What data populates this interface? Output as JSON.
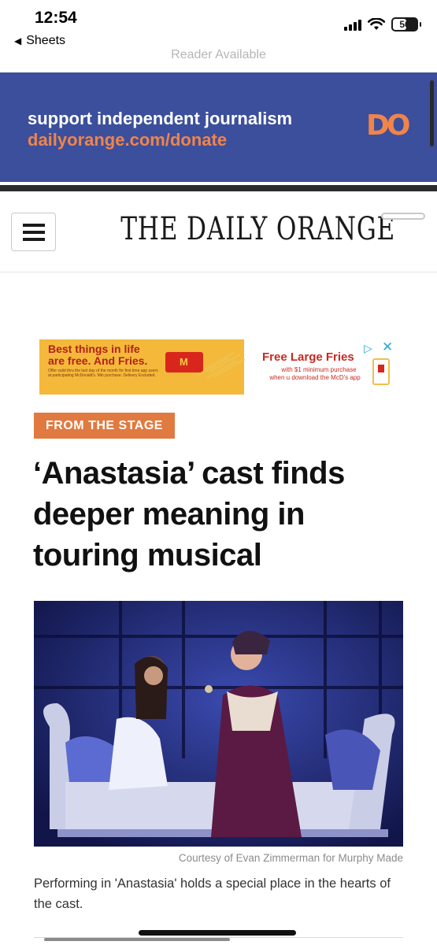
{
  "status_bar": {
    "time": "12:54",
    "back_label": "Sheets",
    "battery": "56",
    "battery_level_pct": 56
  },
  "browser": {
    "reader_label": "Reader Available"
  },
  "donate_banner": {
    "line1": "support independent journalism",
    "line2": "dailyorange.com/donate",
    "logo_text": "DO",
    "background_color": "#3c4f9c",
    "accent_color": "#f0844a"
  },
  "masthead": {
    "title": "THE DAILY ORANGE",
    "menu_icon": "hamburger-icon"
  },
  "ad": {
    "headline_line1": "Best things in life",
    "headline_line2": "are free. And Fries.",
    "fine_print": "Offer valid thru the last day of the month for first time app users at participating McDonald's. Min purchase. Delivery Excluded.",
    "offer_title": "Free Large Fries",
    "offer_sub1": "with $1 minimum purchase",
    "offer_sub2": "when u download the McD's app",
    "choices_icon": "ad-choices-icon",
    "close_glyph": "✕"
  },
  "article": {
    "category": "FROM THE STAGE",
    "category_color": "#e07a41",
    "headline": "‘Anastasia’ cast finds deeper meaning in touring musical",
    "photo_credit": "Courtesy of Evan Zimmerman for Murphy Made",
    "caption": "Performing in 'Anastasia' holds a special place in the hearts of the cast."
  }
}
